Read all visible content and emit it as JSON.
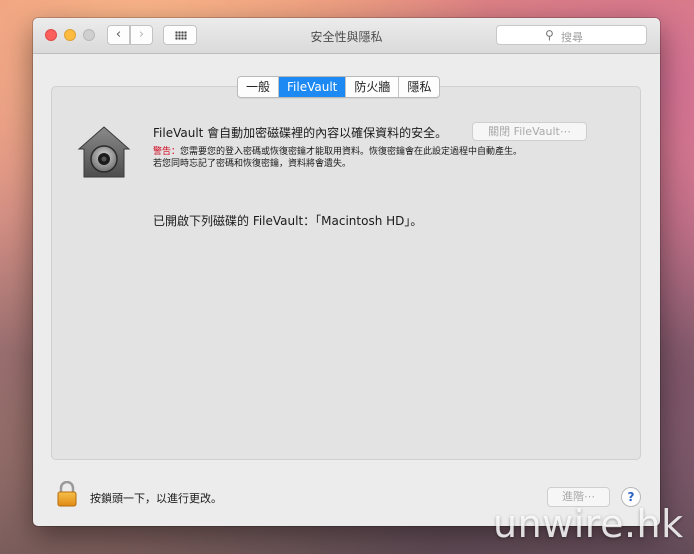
{
  "window": {
    "title": "安全性與隱私"
  },
  "toolbar": {
    "back_icon": "‹",
    "forward_icon": "›",
    "search_icon": "⚲",
    "search_placeholder": "搜尋"
  },
  "tabs": [
    {
      "label": "一般",
      "active": false
    },
    {
      "label": "FileVault",
      "active": true
    },
    {
      "label": "防火牆",
      "active": false
    },
    {
      "label": "隱私",
      "active": false
    }
  ],
  "filevault": {
    "description": "FileVault 會自動加密磁碟裡的內容以確保資料的安全。",
    "turn_off_button": "關閉 FileVault⋯",
    "warning_label": "警告：",
    "warning_line1": "您需要您的登入密碼或恢復密鑰才能取用資料。恢復密鑰會在此設定過程中自動產生。",
    "warning_line2": "若您同時忘記了密碼和恢復密鑰，資料將會遺失。",
    "status": "已開啟下列磁碟的 FileVault：「Macintosh HD」。"
  },
  "footer": {
    "lock_text": "按鎖頭一下，以進行更改。",
    "advanced_button": "進階⋯",
    "help_button": "?"
  },
  "watermark": "unwire.hk",
  "colors": {
    "accent": "#1d8af3",
    "warning": "#d0021b",
    "close": "#fc605c",
    "minimize": "#fdbc40"
  }
}
